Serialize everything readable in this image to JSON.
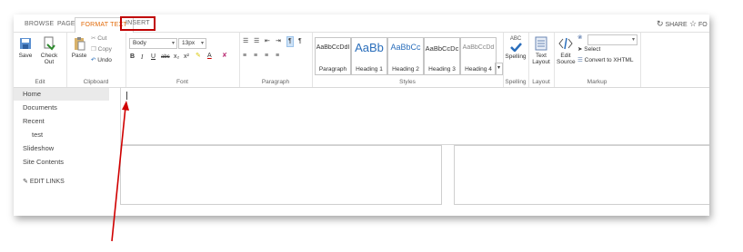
{
  "tabs": [
    {
      "label": "BROWSE"
    },
    {
      "label": "PAGE"
    },
    {
      "label": "FORMAT TEXT"
    },
    {
      "label": "INSERT"
    }
  ],
  "top_right": {
    "share_label": "SHARE",
    "follow_label": "FO"
  },
  "ribbon": {
    "edit": {
      "save_label": "Save",
      "checkout_label": "Check Out",
      "group_label": "Edit"
    },
    "clipboard": {
      "paste_label": "Paste",
      "cut_label": "Cut",
      "copy_label": "Copy",
      "undo_label": "Undo",
      "group_label": "Clipboard"
    },
    "font": {
      "family_value": "Body",
      "size_value": "13px",
      "bold": "B",
      "italic": "I",
      "underline": "U",
      "strike": "abc",
      "subscript": "x₂",
      "superscript": "x²",
      "group_label": "Font"
    },
    "paragraph": {
      "group_label": "Paragraph"
    },
    "styles": {
      "items": [
        {
          "sample": "AaBbCcDdI",
          "name": "Paragraph"
        },
        {
          "sample": "AaBb",
          "name": "Heading 1"
        },
        {
          "sample": "AaBbCc",
          "name": "Heading 2"
        },
        {
          "sample": "AaBbCcDc",
          "name": "Heading 3"
        },
        {
          "sample": "AaBbCcDd",
          "name": "Heading 4"
        }
      ],
      "group_label": "Styles"
    },
    "spelling": {
      "label": "Spelling",
      "abc": "ABC",
      "group_label": "Spelling"
    },
    "layout": {
      "label": "Text Layout",
      "group_label": "Layout"
    },
    "markup": {
      "edit_source_label": "Edit Source",
      "select_label": "Select",
      "convert_label": "Convert to XHTML",
      "group_label": "Markup"
    }
  },
  "nav": {
    "items": [
      {
        "label": "Home"
      },
      {
        "label": "Documents"
      },
      {
        "label": "Recent"
      },
      {
        "label": "test"
      },
      {
        "label": "Slideshow"
      },
      {
        "label": "Site Contents"
      }
    ],
    "edit_links_label": "EDIT LINKS"
  },
  "colors": {
    "accent": "#e26b0a",
    "highlight": "#c00000",
    "arrow": "#d00000",
    "style_blue": "#2a6ebb"
  }
}
